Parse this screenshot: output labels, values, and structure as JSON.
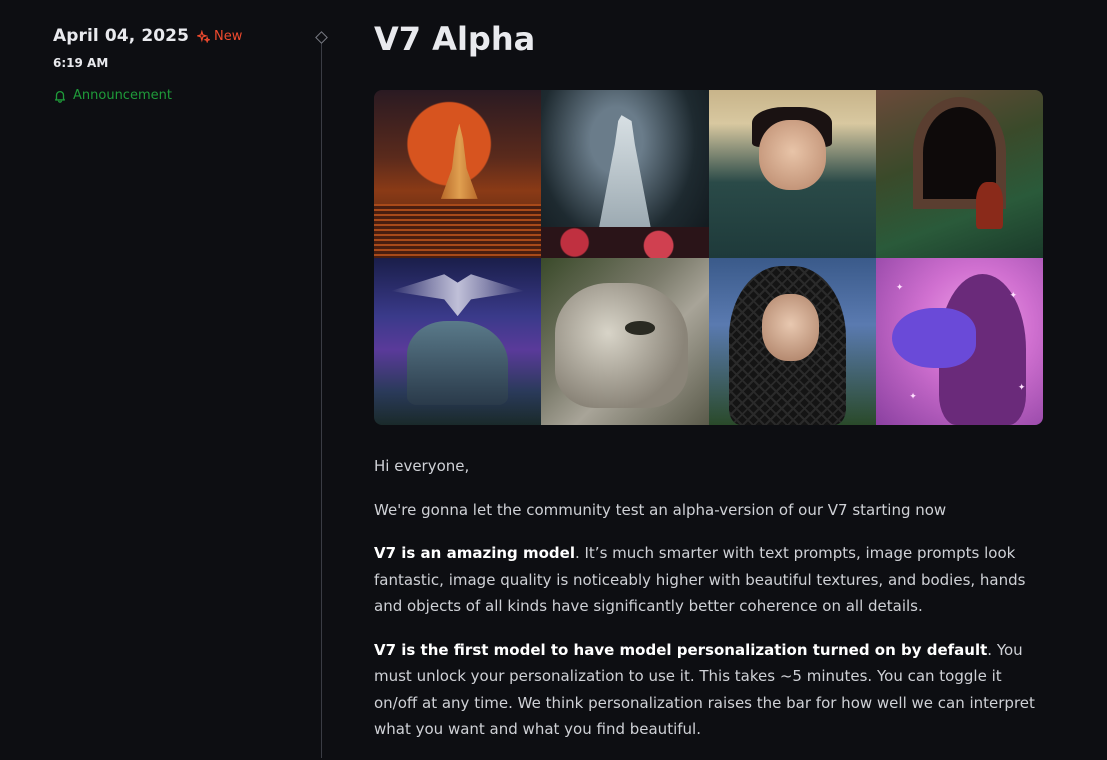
{
  "entry": {
    "date": "April 04, 2025",
    "badge": "New",
    "time": "6:19 AM",
    "category": "Announcement",
    "category_icon": "bell-icon",
    "badge_icon": "sparkle-icon"
  },
  "colors": {
    "background": "#0d0e12",
    "badge": "#f04a2e",
    "category": "#1f9b3a",
    "title": "#e9eaee"
  },
  "post": {
    "title": "V7 Alpha",
    "paragraphs": {
      "greeting": "Hi everyone,",
      "intro": "We're gonna let the community test an alpha-version of our V7 starting now",
      "p3_bold": "V7 is an amazing model",
      "p3_rest": ". It’s much smarter with text prompts, image prompts look fantastic, image quality is noticeably higher with beautiful textures, and bodies, hands and objects of all kinds have significantly better coherence on all details.",
      "p4_bold": "V7 is the first model to have model personalization turned on by default",
      "p4_rest": ". You must unlock your personalization to use it. This takes ~5 minutes. You can toggle it on/off at any time. We think personalization raises the bar for how well we can interpret what you want and what you find beautiful."
    }
  }
}
